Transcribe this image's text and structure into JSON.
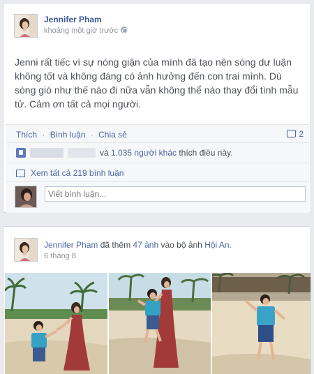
{
  "post1": {
    "author": "Jennifer Pham",
    "time": "khoảng một giờ trước",
    "text": "Jenni rất tiếc vì sự nóng giận của mình đã tạo nên sóng dư luận không tốt và không đáng có ảnh hưởng đến con trai mình. Dù sóng gió như thế nào đi nữa vẫn không thể nào thay đổi tình mẫu tử. Cảm ơn tất cả mọi người.",
    "actions": {
      "like": "Thích",
      "comment": "Bình luận",
      "share": "Chia sẻ",
      "sep": "·",
      "comment_count": "2"
    },
    "likes": {
      "conj": "và",
      "others": "1.035 người khác",
      "suffix": "thích điều này."
    },
    "view_all": "Xem tất cả 219 bình luận",
    "comment_placeholder": "Viết bình luận..."
  },
  "post2": {
    "author": "Jennifer Pham",
    "verb": "đã thêm",
    "count": "47 ảnh",
    "mid": "vào bộ ảnh",
    "album": "Hội An.",
    "time": "6 tháng 8"
  },
  "colors": {
    "link": "#3b5998",
    "background": "#e9ebee"
  },
  "icons": [
    "globe-icon",
    "comment-icon",
    "like-thumb-icon",
    "view-comments-icon"
  ]
}
